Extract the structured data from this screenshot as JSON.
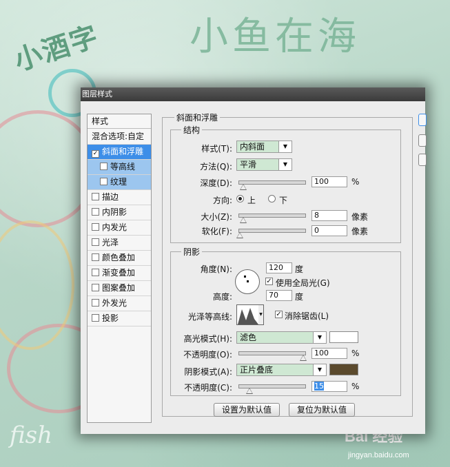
{
  "background": {
    "title": "小鱼在海",
    "logo": "小酒字",
    "signature": "fish",
    "watermark": "Bai 经验",
    "watermark_url": "jingyan.baidu.com"
  },
  "dialog": {
    "title": "图层样式",
    "styles_header": "样式",
    "blend_options": "混合选项:自定",
    "style_items": [
      {
        "label": "斜面和浮雕",
        "checked": true,
        "selected": true
      },
      {
        "label": "等高线",
        "checked": false,
        "sub": true
      },
      {
        "label": "纹理",
        "checked": false,
        "sub": true
      },
      {
        "label": "描边",
        "checked": false
      },
      {
        "label": "内阴影",
        "checked": false
      },
      {
        "label": "内发光",
        "checked": false
      },
      {
        "label": "光泽",
        "checked": false
      },
      {
        "label": "颜色叠加",
        "checked": false
      },
      {
        "label": "渐变叠加",
        "checked": false
      },
      {
        "label": "图案叠加",
        "checked": false
      },
      {
        "label": "外发光",
        "checked": false
      },
      {
        "label": "投影",
        "checked": false
      }
    ],
    "bevel": {
      "group_title": "斜面和浮雕",
      "structure_title": "结构",
      "style_label": "样式(T):",
      "style_value": "内斜面",
      "technique_label": "方法(Q):",
      "technique_value": "平滑",
      "depth_label": "深度(D):",
      "depth_value": "100",
      "depth_unit": "%",
      "direction_label": "方向:",
      "direction_up": "上",
      "direction_down": "下",
      "size_label": "大小(Z):",
      "size_value": "8",
      "size_unit": "像素",
      "soften_label": "软化(F):",
      "soften_value": "0",
      "soften_unit": "像素"
    },
    "shading": {
      "title": "阴影",
      "angle_label": "角度(N):",
      "angle_value": "120",
      "angle_unit": "度",
      "global_light_label": "使用全局光(G)",
      "altitude_label": "高度:",
      "altitude_value": "70",
      "altitude_unit": "度",
      "gloss_contour_label": "光泽等高线:",
      "antialias_label": "消除锯齿(L)",
      "highlight_mode_label": "高光模式(H):",
      "highlight_mode_value": "滤色",
      "highlight_color": "#ffffff",
      "highlight_opacity_label": "不透明度(O):",
      "highlight_opacity_value": "100",
      "highlight_opacity_unit": "%",
      "shadow_mode_label": "阴影模式(A):",
      "shadow_mode_value": "正片叠底",
      "shadow_color": "#5b4a2d",
      "shadow_opacity_label": "不透明度(C):",
      "shadow_opacity_value": "15",
      "shadow_opacity_unit": "%"
    },
    "buttons": {
      "make_default": "设置为默认值",
      "reset_default": "复位为默认值"
    }
  }
}
